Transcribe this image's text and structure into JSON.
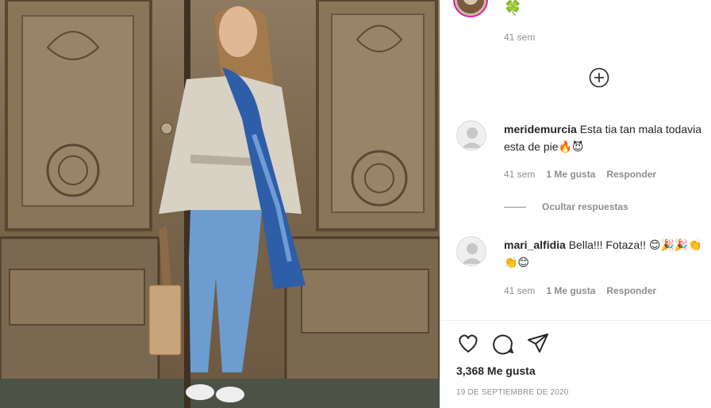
{
  "post": {
    "caption_emoji": "🍀",
    "caption_time": "41 sem"
  },
  "comments": [
    {
      "username": "meridemurcia",
      "text": "Esta tia tan mala todavia esta de pie🔥😈",
      "time": "41 sem",
      "likes": "1 Me gusta",
      "reply": "Responder"
    },
    {
      "username": "mari_alfidia",
      "text": "Bella!!! Fotaza!! 😊🎉🎉👏👏😊",
      "time": "41 sem",
      "likes": "1 Me gusta",
      "reply": "Responder"
    }
  ],
  "hide_replies_label": "Ocultar respuestas",
  "likes_total": "3,368 Me gusta",
  "post_date": "19 DE SEPTIEMBRE DE 2020",
  "colors": {
    "text_primary": "#262626",
    "text_secondary": "#8e8e8e",
    "divider": "#efefef",
    "story_ring": "#d6249f"
  },
  "icons": [
    "clover-emoji",
    "add-circle-icon",
    "heart-icon",
    "comment-icon",
    "share-icon"
  ]
}
